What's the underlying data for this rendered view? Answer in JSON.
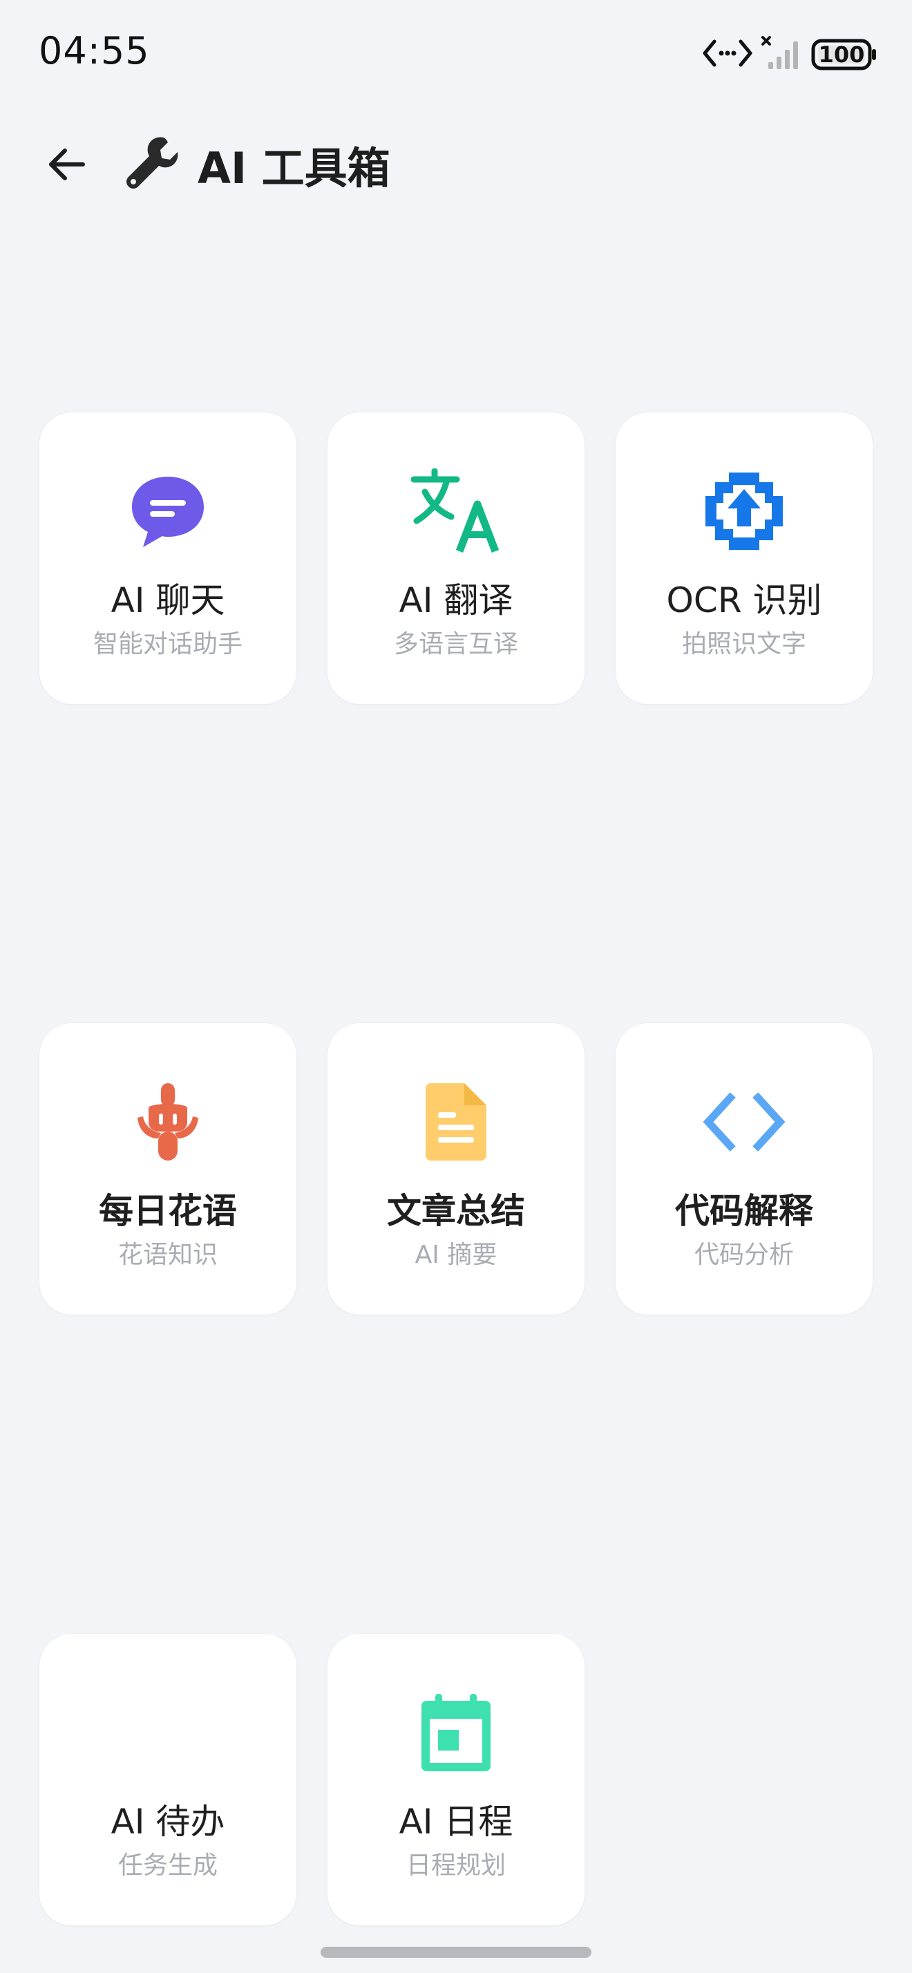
{
  "status_bar": {
    "time": "04:55",
    "battery": "100"
  },
  "header": {
    "title": "AI 工具箱"
  },
  "tools": [
    {
      "label": "AI 聊天",
      "sub": "智能对话助手",
      "icon": "chat-bubble-icon",
      "color": "#6e5ae8"
    },
    {
      "label": "AI 翻译",
      "sub": "多语言互译",
      "icon": "translate-icon",
      "color": "#12b886"
    },
    {
      "label": "OCR 识别",
      "sub": "拍照识文字",
      "icon": "ocr-scan-icon",
      "color": "#1677e8"
    },
    {
      "label": "每日花语",
      "sub": "花语知识",
      "icon": "flower-icon",
      "color": "#e8684a"
    },
    {
      "label": "文章总结",
      "sub": "AI 摘要",
      "icon": "document-icon",
      "color": "#ffcd6b"
    },
    {
      "label": "代码解释",
      "sub": "代码分析",
      "icon": "code-icon",
      "color": "#5aa7f5"
    },
    {
      "label": "AI 待办",
      "sub": "任务生成",
      "icon": "",
      "color": ""
    },
    {
      "label": "AI 日程",
      "sub": "日程规划",
      "icon": "calendar-icon",
      "color": "#3fe0b0"
    }
  ]
}
